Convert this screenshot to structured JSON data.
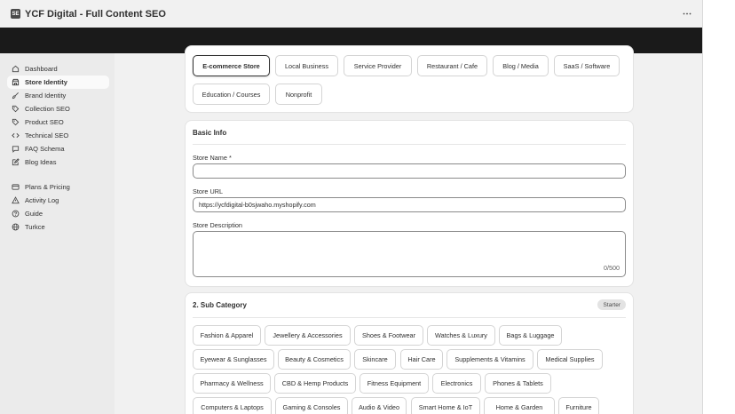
{
  "titlebar": {
    "logo_text": "SE",
    "title": "YCF Digital - Full Content SEO"
  },
  "sidebar": {
    "items": [
      {
        "label": "Dashboard",
        "icon": "home-icon"
      },
      {
        "label": "Store Identity",
        "icon": "store-icon",
        "active": true
      },
      {
        "label": "Brand Identity",
        "icon": "brush-icon"
      },
      {
        "label": "Collection SEO",
        "icon": "tag-icon"
      },
      {
        "label": "Product SEO",
        "icon": "tag-icon"
      },
      {
        "label": "Technical SEO",
        "icon": "code-icon"
      },
      {
        "label": "FAQ Schema",
        "icon": "chat-icon"
      },
      {
        "label": "Blog Ideas",
        "icon": "edit-icon"
      }
    ],
    "secondary_items": [
      {
        "label": "Plans & Pricing",
        "icon": "credit-card-icon"
      },
      {
        "label": "Activity Log",
        "icon": "alert-icon"
      },
      {
        "label": "Guide",
        "icon": "help-icon"
      },
      {
        "label": "Turkce",
        "icon": "globe-icon"
      }
    ]
  },
  "store_type": {
    "options": [
      "E-commerce Store",
      "Local Business",
      "Service Provider",
      "Restaurant / Cafe",
      "Blog / Media",
      "SaaS / Software",
      "Education / Courses",
      "Nonprofit"
    ],
    "selected": "E-commerce Store"
  },
  "basic_info": {
    "title": "Basic Info",
    "store_name_label": "Store Name *",
    "store_name_value": "",
    "store_url_label": "Store URL",
    "store_url_value": "https://ycfdigital-b0sjwaho.myshopify.com",
    "store_description_label": "Store Description",
    "store_description_value": "",
    "description_count": "0/500"
  },
  "sub_category": {
    "title": "2. Sub Category",
    "badge": "Starter",
    "options": [
      "Fashion & Apparel",
      "Jewellery & Accessories",
      "Shoes & Footwear",
      "Watches & Luxury",
      "Bags & Luggage",
      "Eyewear & Sunglasses",
      "Beauty & Cosmetics",
      "Skincare",
      "Hair Care",
      "Supplements & Vitamins",
      "Medical Supplies",
      "Pharmacy & Wellness",
      "CBD & Hemp Products",
      "Fitness Equipment",
      "Electronics",
      "Phones & Tablets",
      "Computers & Laptops",
      "Gaming & Consoles",
      "Audio & Video",
      "Smart Home & IoT",
      "Home & Garden",
      "Furniture"
    ]
  }
}
